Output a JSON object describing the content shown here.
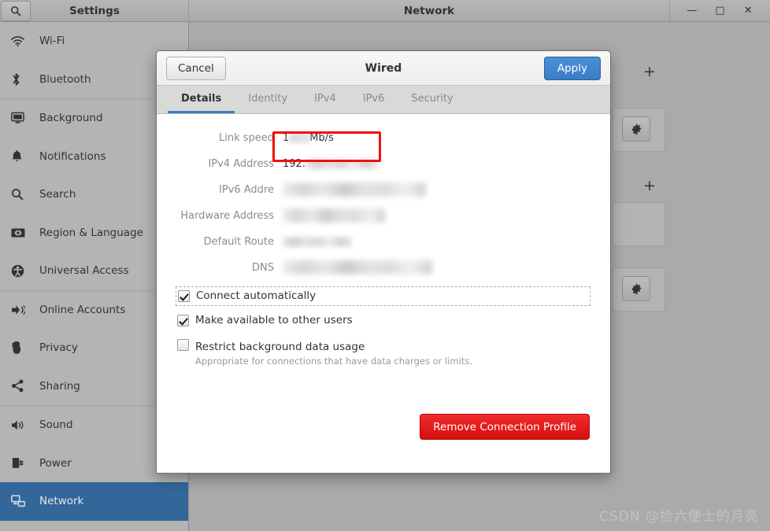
{
  "titlebar": {
    "search_icon": "search-icon",
    "settings_title": "Settings",
    "network_title": "Network",
    "minimize": "—",
    "maximize": "□",
    "close": "✕"
  },
  "sidebar": {
    "items": [
      {
        "label": "Wi-Fi",
        "icon": "wifi-icon",
        "selected": false
      },
      {
        "label": "Bluetooth",
        "icon": "bluetooth-icon",
        "selected": false
      },
      {
        "label": "Background",
        "icon": "background-icon",
        "selected": false
      },
      {
        "label": "Notifications",
        "icon": "bell-icon",
        "selected": false
      },
      {
        "label": "Search",
        "icon": "search-icon",
        "selected": false
      },
      {
        "label": "Region & Language",
        "icon": "flag-icon",
        "selected": false
      },
      {
        "label": "Universal Access",
        "icon": "accessibility-icon",
        "selected": false
      },
      {
        "label": "Online Accounts",
        "icon": "online-accounts-icon",
        "selected": false
      },
      {
        "label": "Privacy",
        "icon": "hand-icon",
        "selected": false
      },
      {
        "label": "Sharing",
        "icon": "share-icon",
        "selected": false
      },
      {
        "label": "Sound",
        "icon": "speaker-icon",
        "selected": false
      },
      {
        "label": "Power",
        "icon": "power-plug-icon",
        "selected": false
      },
      {
        "label": "Network",
        "icon": "network-icon",
        "selected": true
      }
    ]
  },
  "background_panel": {
    "add_buttons": [
      {
        "label": "+",
        "name": "add-connection-button-1"
      },
      {
        "label": "+",
        "name": "add-connection-button-2"
      }
    ],
    "gear_buttons": [
      {
        "icon": "gear-icon",
        "name": "connection-settings-button-1"
      },
      {
        "icon": "gear-icon",
        "name": "connection-settings-button-2"
      }
    ]
  },
  "dialog": {
    "cancel_label": "Cancel",
    "title": "Wired",
    "apply_label": "Apply",
    "tabs": [
      {
        "label": "Details",
        "active": true
      },
      {
        "label": "Identity",
        "active": false
      },
      {
        "label": "IPv4",
        "active": false
      },
      {
        "label": "IPv6",
        "active": false
      },
      {
        "label": "Security",
        "active": false
      }
    ],
    "fields": [
      {
        "label": "Link speed",
        "value_prefix": "1",
        "value_suffix": " Mb/s",
        "redacted": true,
        "redact_width": 26,
        "highlighted": false
      },
      {
        "label": "IPv4 Address",
        "value_prefix": "192.",
        "value_suffix": "",
        "redacted": true,
        "redact_width": 92,
        "highlighted": true
      },
      {
        "label": "IPv6 Addre",
        "value_prefix": "",
        "value_suffix": "",
        "redacted": true,
        "redact_width": 182,
        "highlighted": false
      },
      {
        "label": "Hardware Address",
        "value_prefix": "",
        "value_suffix": "",
        "redacted": true,
        "redact_width": 130,
        "highlighted": false
      },
      {
        "label": "Default Route",
        "value_prefix": "",
        "value_suffix": "",
        "redacted": true,
        "redact_width": 88,
        "highlighted": false
      },
      {
        "label": "DNS",
        "value_prefix": "",
        "value_suffix": "",
        "redacted": true,
        "redact_width": 190,
        "highlighted": false
      }
    ],
    "checkboxes": [
      {
        "label": "Connect automatically",
        "sublabel": "",
        "checked": true,
        "focused": true
      },
      {
        "label": "Make available to other users",
        "sublabel": "",
        "checked": true,
        "focused": false
      },
      {
        "label": "Restrict background data usage",
        "sublabel": "Appropriate for connections that have data charges or limits.",
        "checked": false,
        "focused": false
      }
    ],
    "remove_label": "Remove Connection Profile"
  },
  "watermark": {
    "text": "CSDN @捡六便士的月亮"
  },
  "colors": {
    "accent_blue": "#336699",
    "apply_blue": "#3b7dc4",
    "danger_red": "#d90e0e",
    "highlight_red": "#ee1111",
    "chrome_gray": "#aaaaaa",
    "sidebar_gray": "#b4b4b2"
  }
}
